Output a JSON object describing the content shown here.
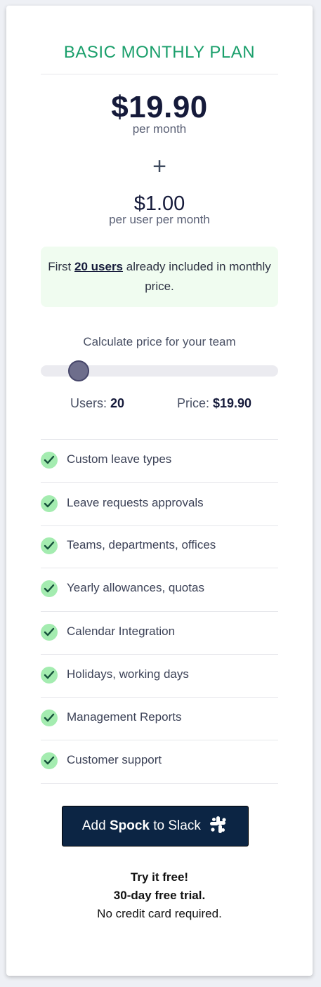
{
  "plan": {
    "title": "BASIC MONTHLY PLAN",
    "price": "$19.90",
    "price_period": "per month",
    "plus_symbol": "+",
    "per_user_price": "$1.00",
    "per_user_period": "per user per month"
  },
  "notice": {
    "prefix": "First ",
    "highlight": "20 users",
    "suffix": " already included in monthly price."
  },
  "calculator": {
    "label": "Calculate price for your team",
    "users_label": "Users: ",
    "users_value": "20",
    "price_label": "Price: ",
    "price_value": "$19.90",
    "slider_fraction": 0.11
  },
  "features": [
    {
      "label": "Custom leave types",
      "icon": "check-icon"
    },
    {
      "label": "Leave requests approvals",
      "icon": "check-icon"
    },
    {
      "label": "Teams, departments, offices",
      "icon": "check-icon"
    },
    {
      "label": "Yearly allowances, quotas",
      "icon": "check-icon"
    },
    {
      "label": "Calendar Integration",
      "icon": "check-icon"
    },
    {
      "label": "Holidays, working days",
      "icon": "check-icon"
    },
    {
      "label": "Management Reports",
      "icon": "check-icon"
    },
    {
      "label": "Customer support",
      "icon": "check-icon"
    }
  ],
  "cta": {
    "prefix": "Add ",
    "brand": "Spock",
    "suffix": " to Slack",
    "icon": "slack-icon"
  },
  "trial": {
    "line1": "Try it free!",
    "line2": "30-day free trial.",
    "line3": "No credit card required."
  },
  "colors": {
    "accent": "#1a9f6b",
    "cta_background": "#0c2544",
    "notice_background": "#f0fcf0",
    "check_background": "#a4ecb0"
  }
}
